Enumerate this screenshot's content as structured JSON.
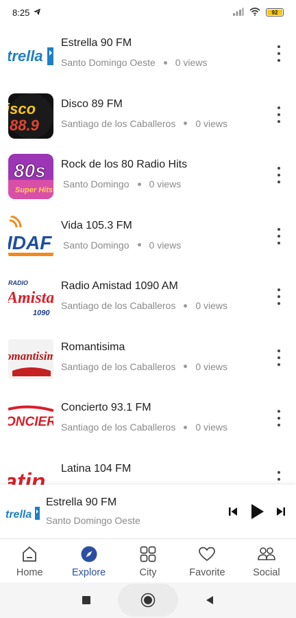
{
  "status_bar": {
    "time": "8:25",
    "battery_level": "92"
  },
  "stations": [
    {
      "title": "Estrella 90 FM",
      "location": "Santo Domingo Oeste",
      "views": "0 views",
      "logo_text": "trella"
    },
    {
      "title": "Disco 89 FM",
      "location": "Santiago de los Caballeros",
      "views": "0 views",
      "logo_text": "isco 88.9"
    },
    {
      "title": "Rock de los 80 Radio Hits",
      "location": "Santo Domingo",
      "views": "0 views",
      "logo_text": "80s"
    },
    {
      "title": "Vida 105.3 FM",
      "location": "Santo Domingo",
      "views": "0 views",
      "logo_text": "IDAF"
    },
    {
      "title": "Radio Amistad 1090 AM",
      "location": "Santiago de los Caballeros",
      "views": "0 views",
      "logo_text": "Amistad"
    },
    {
      "title": "Romantisima",
      "location": "Santiago de los Caballeros",
      "views": "0 views",
      "logo_text": "omantisim"
    },
    {
      "title": "Concierto 93.1 FM",
      "location": "Santiago de los Caballeros",
      "views": "0 views",
      "logo_text": "ONCIER"
    },
    {
      "title": "Latina 104 FM",
      "location": "",
      "views": "",
      "logo_text": "atin"
    }
  ],
  "mini_player": {
    "title": "Estrella 90 FM",
    "subtitle": "Santo Domingo Oeste",
    "logo_text": "trella"
  },
  "nav": [
    {
      "label": "Home",
      "icon": "home-icon"
    },
    {
      "label": "Explore",
      "icon": "compass-icon"
    },
    {
      "label": "City",
      "icon": "grid-icon"
    },
    {
      "label": "Favorite",
      "icon": "heart-icon"
    },
    {
      "label": "Social",
      "icon": "people-icon"
    }
  ],
  "colors": {
    "accent": "#2c4fa3",
    "muted_text": "#8a8a8a"
  }
}
